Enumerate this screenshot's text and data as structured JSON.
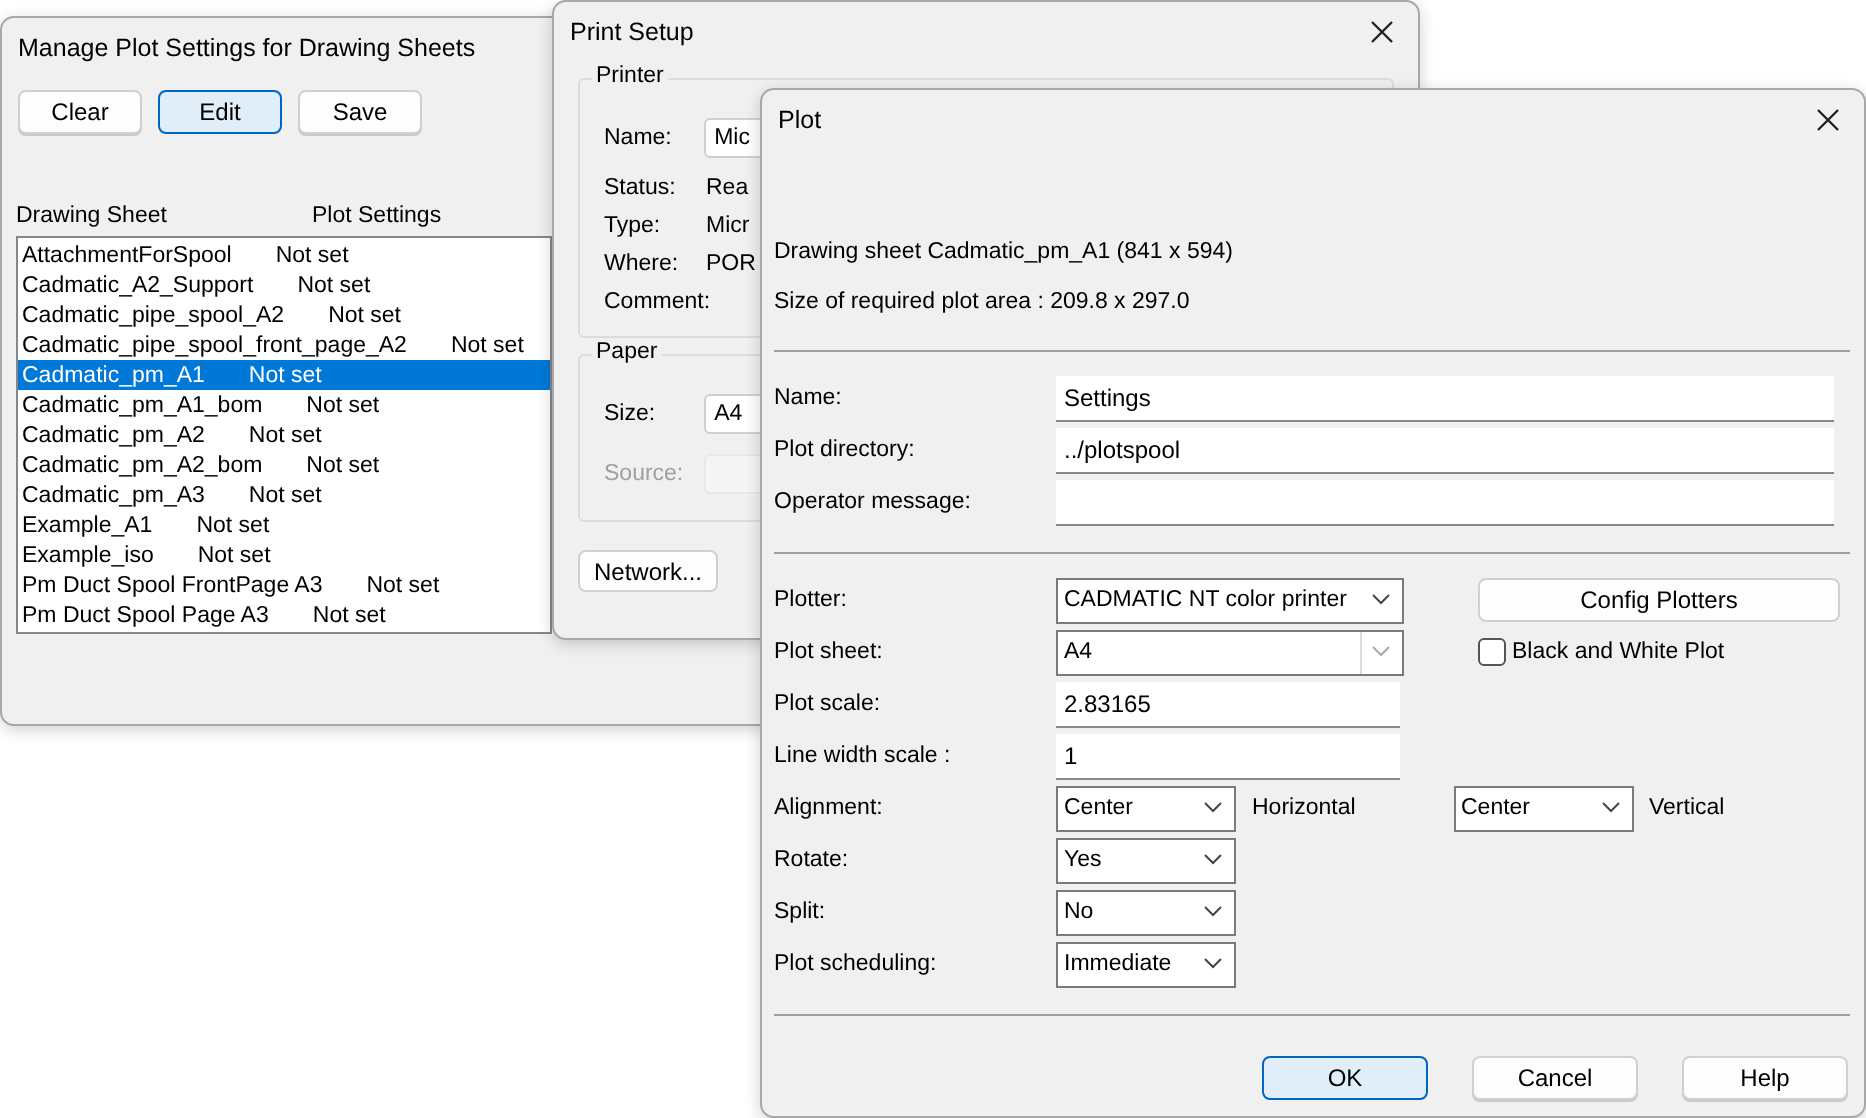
{
  "manage_window": {
    "title": "Manage Plot Settings for Drawing Sheets",
    "buttons": [
      {
        "label": "Clear",
        "selected": false
      },
      {
        "label": "Edit",
        "selected": true
      },
      {
        "label": "Save",
        "selected": false
      }
    ],
    "columns": [
      "Drawing Sheet",
      "Plot Settings"
    ],
    "rows": [
      {
        "sheet": "AttachmentForSpool",
        "plot_settings": "Not set",
        "selected": false
      },
      {
        "sheet": "Cadmatic_A2_Support",
        "plot_settings": "Not set",
        "selected": false
      },
      {
        "sheet": "Cadmatic_pipe_spool_A2",
        "plot_settings": "Not set",
        "selected": false
      },
      {
        "sheet": "Cadmatic_pipe_spool_front_page_A2",
        "plot_settings": "Not set",
        "selected": false
      },
      {
        "sheet": "Cadmatic_pm_A1",
        "plot_settings": "Not set",
        "selected": true
      },
      {
        "sheet": "Cadmatic_pm_A1_bom",
        "plot_settings": "Not set",
        "selected": false
      },
      {
        "sheet": "Cadmatic_pm_A2",
        "plot_settings": "Not set",
        "selected": false
      },
      {
        "sheet": "Cadmatic_pm_A2_bom",
        "plot_settings": "Not set",
        "selected": false
      },
      {
        "sheet": "Cadmatic_pm_A3",
        "plot_settings": "Not set",
        "selected": false
      },
      {
        "sheet": "Example_A1",
        "plot_settings": "Not set",
        "selected": false
      },
      {
        "sheet": "Example_iso",
        "plot_settings": "Not set",
        "selected": false
      },
      {
        "sheet": "Pm Duct Spool FrontPage A3",
        "plot_settings": "Not set",
        "selected": false
      },
      {
        "sheet": "Pm Duct Spool Page A3",
        "plot_settings": "Not set",
        "selected": false
      }
    ]
  },
  "print_setup": {
    "title": "Print Setup",
    "printer_group": {
      "title": "Printer",
      "fields": [
        {
          "kind": "field",
          "label": "Name:",
          "value": "Mic"
        },
        {
          "kind": "text",
          "label": "Status:",
          "value": "Rea"
        },
        {
          "kind": "text",
          "label": "Type:",
          "value": "Micr"
        },
        {
          "kind": "text",
          "label": "Where:",
          "value": "POR"
        },
        {
          "kind": "text",
          "label": "Comment:"
        }
      ]
    },
    "paper_group": {
      "title": "Paper",
      "fields": [
        {
          "kind": "field",
          "label": "Size:",
          "value": "A4",
          "disabled": false
        },
        {
          "kind": "field",
          "label": "Source:",
          "disabled": true
        }
      ]
    },
    "network_button": "Network..."
  },
  "plot": {
    "title": "Plot",
    "info": [
      "Drawing sheet Cadmatic_pm_A1 (841 x 594)",
      "Size of required plot area : 209.8 x 297.0"
    ],
    "text_fields": [
      {
        "label": "Name:",
        "value": "Settings"
      },
      {
        "label": "Plot directory:",
        "value": "../plotspool"
      },
      {
        "label": "Operator message:"
      }
    ],
    "settings": [
      {
        "kind": "select",
        "label": "Plotter:",
        "value": "CADMATIC NT color printer",
        "side": {
          "kind": "button",
          "label": "Config Plotters"
        }
      },
      {
        "kind": "combo",
        "label": "Plot sheet:",
        "value": "A4",
        "side": {
          "kind": "checkbox",
          "label": "Black and White Plot",
          "checked": false
        }
      },
      {
        "kind": "input",
        "label": "Plot scale:",
        "value": "2.83165"
      },
      {
        "kind": "input",
        "label": "Line width scale :",
        "value": "1"
      },
      {
        "kind": "dropdown",
        "label": "Alignment:",
        "value": "Center",
        "note": "Horizontal",
        "side": {
          "kind": "dropdown",
          "value": "Center",
          "note": "Vertical"
        }
      },
      {
        "kind": "dropdown",
        "label": "Rotate:",
        "value": "Yes"
      },
      {
        "kind": "dropdown",
        "label": "Split:",
        "value": "No"
      },
      {
        "kind": "dropdown",
        "label": "Plot scheduling:",
        "value": "Immediate"
      }
    ],
    "buttons": [
      {
        "label": "OK",
        "selected": true
      },
      {
        "label": "Cancel",
        "selected": false
      },
      {
        "label": "Help",
        "selected": false
      }
    ]
  }
}
